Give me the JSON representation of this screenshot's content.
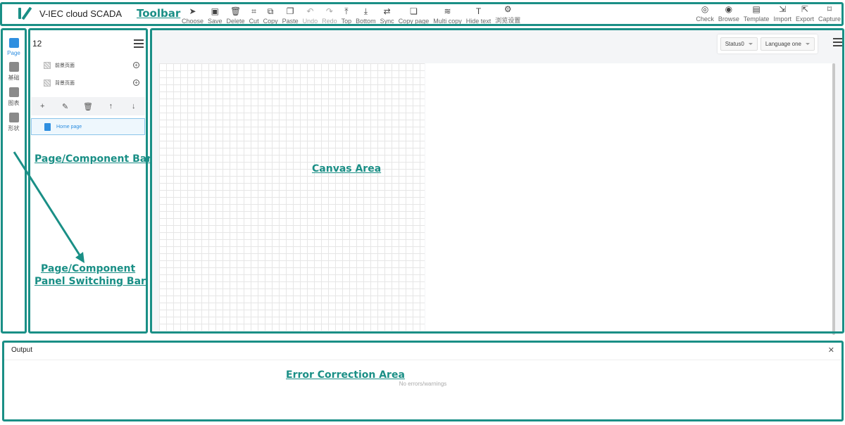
{
  "app": {
    "title": "V-IEC cloud SCADA"
  },
  "toolbar": {
    "tools": [
      {
        "label": "Choose",
        "icon": "cursor-icon"
      },
      {
        "label": "Save",
        "icon": "save-icon"
      },
      {
        "label": "Delete",
        "icon": "trash-icon"
      },
      {
        "label": "Cut",
        "icon": "crop-icon"
      },
      {
        "label": "Copy",
        "icon": "copy-icon"
      },
      {
        "label": "Paste",
        "icon": "paste-icon"
      },
      {
        "label": "Undo",
        "icon": "undo-icon",
        "disabled": true
      },
      {
        "label": "Redo",
        "icon": "redo-icon",
        "disabled": true
      },
      {
        "label": "Top",
        "icon": "arrow-top-icon"
      },
      {
        "label": "Bottom",
        "icon": "arrow-bottom-icon"
      },
      {
        "label": "Sync",
        "icon": "sync-icon"
      },
      {
        "label": "Copy page",
        "icon": "copy-page-icon"
      },
      {
        "label": "Multi copy",
        "icon": "layers-icon"
      },
      {
        "label": "Hide text",
        "icon": "text-icon"
      },
      {
        "label": "浏览设置",
        "icon": "gear-icon"
      }
    ],
    "right_tools": [
      {
        "label": "Check",
        "icon": "check-icon"
      },
      {
        "label": "Browse",
        "icon": "eye-icon"
      },
      {
        "label": "Template",
        "icon": "template-icon"
      },
      {
        "label": "Import",
        "icon": "import-icon"
      },
      {
        "label": "Export",
        "icon": "export-icon"
      },
      {
        "label": "Capture",
        "icon": "capture-icon"
      }
    ]
  },
  "switchbar": {
    "items": [
      {
        "label": "Page",
        "active": true
      },
      {
        "label": "基础",
        "active": false
      },
      {
        "label": "图表",
        "active": false
      },
      {
        "label": "形状",
        "active": false
      }
    ]
  },
  "panel": {
    "count": "12",
    "rows": [
      {
        "name": "前景页面"
      },
      {
        "name": "背景页面"
      }
    ],
    "actions": [
      "+",
      "✎",
      "🗑",
      "↑",
      "↓"
    ],
    "selected_page": "Home page"
  },
  "canvas": {
    "status_select": "Status0",
    "language_select": "Language one"
  },
  "output": {
    "title": "Output",
    "message": "No errors/warnings"
  },
  "annotations": {
    "toolbar": "Toolbar",
    "page_component_bar": "Page/Component Bar",
    "canvas_area": "Canvas Area",
    "switching_bar_line1": "Page/Component",
    "switching_bar_line2": "Panel Switching Bar",
    "error_area": "Error Correction Area"
  },
  "colors": {
    "annotation": "#1a8f86",
    "accent": "#2f8fe0"
  }
}
